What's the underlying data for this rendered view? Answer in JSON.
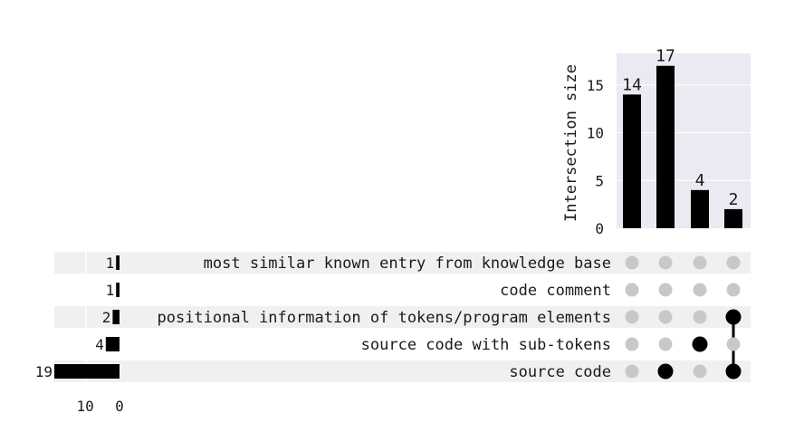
{
  "chart_data": {
    "type": "upset",
    "sets": [
      "most similar known entry from knowledge base",
      "code comment",
      "positional information of tokens/program elements",
      "source code with sub-tokens",
      "source code"
    ],
    "set_sizes": [
      1,
      1,
      2,
      4,
      19
    ],
    "set_size_ticks": [
      10,
      0
    ],
    "intersections": [
      {
        "members": [],
        "size": 14
      },
      {
        "members": [
          "source code"
        ],
        "size": 17
      },
      {
        "members": [
          "source code with sub-tokens"
        ],
        "size": 4
      },
      {
        "members": [
          "positional information of tokens/program elements",
          "source code"
        ],
        "size": 2
      }
    ],
    "intersection_ylabel": "Intersection size",
    "intersection_yticks": [
      0,
      5,
      10,
      15
    ],
    "intersection_ylim": [
      0,
      18.3
    ],
    "colors": {
      "bar": "#000000",
      "dot_active": "#000000",
      "dot_inactive": "#c8c8c8",
      "plot_bg": "#eaeaf2",
      "row_shade": "#f0f0f0",
      "grid": "#ffffff"
    }
  }
}
